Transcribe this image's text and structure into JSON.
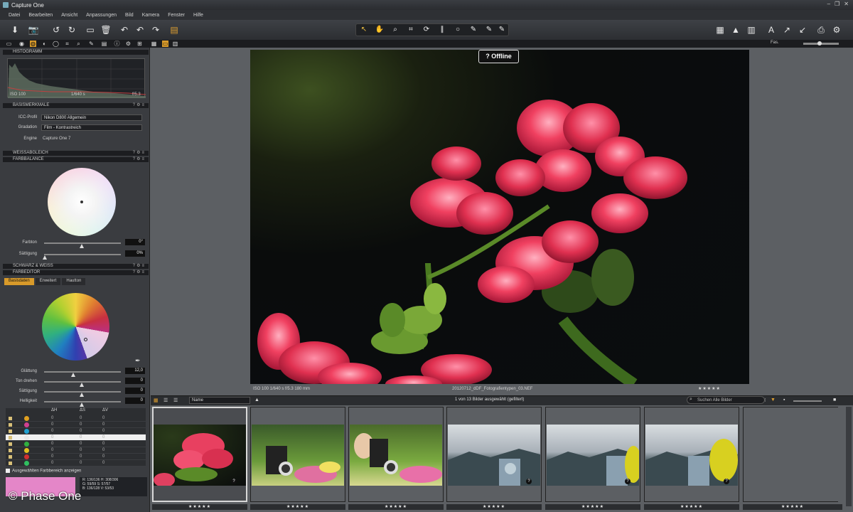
{
  "window": {
    "title": "Capture One"
  },
  "menu": [
    "Datei",
    "Bearbeiten",
    "Ansicht",
    "Anpassungen",
    "Bild",
    "Kamera",
    "Fenster",
    "Hilfe"
  ],
  "toolbar": {
    "fas_label": "Fas."
  },
  "sidebar": {
    "histogram": {
      "title": "Histogramm",
      "iso": "ISO 100",
      "shutter": "1/640 s",
      "aperture": "f/5.3"
    },
    "base": {
      "title": "Basismerkmale",
      "icc_label": "ICC-Profil",
      "icc_value": "Nikon D800 Allgemein",
      "curve_label": "Gradation",
      "curve_value": "Film - Kontrastreich",
      "engine_label": "Engine",
      "engine_value": "Capture One 7"
    },
    "wb": {
      "title": "Weissabgleich"
    },
    "colorbalance": {
      "title": "Farbbalance",
      "hue_label": "Farbton",
      "hue_value": "0°",
      "sat_label": "Sättigung",
      "sat_value": "0%"
    },
    "bw": {
      "title": "Schwarz & Weiß"
    },
    "coloreditor": {
      "title": "Farbeditor",
      "tabs": [
        "Basisdaten",
        "Erweitert",
        "Hautton"
      ],
      "smooth_label": "Glättung",
      "smooth_value": "12,0",
      "rot_label": "Ton drehen",
      "rot_value": "0",
      "sat_label": "Sättigung",
      "sat_value": "0",
      "light_label": "Helligkeit",
      "light_value": "0"
    },
    "cc_headers": [
      "ΔH",
      "ΔS",
      "ΔV"
    ],
    "cc_rows": [
      {
        "color": "#e0a020",
        "vals": [
          "0",
          "0",
          "0"
        ]
      },
      {
        "color": "#d04090",
        "vals": [
          "0",
          "0",
          "0"
        ]
      },
      {
        "color": "#20a0d0",
        "vals": [
          "0",
          "0",
          "0"
        ]
      },
      {
        "color": "#e8e8e8",
        "vals": [
          "0",
          "0",
          "0"
        ],
        "selected": true
      },
      {
        "color": "#30b040",
        "vals": [
          "0",
          "0",
          "0"
        ]
      },
      {
        "color": "#e0c020",
        "vals": [
          "0",
          "0",
          "0"
        ]
      },
      {
        "color": "#d03030",
        "vals": [
          "0",
          "0",
          "0"
        ]
      },
      {
        "color": "#30c060",
        "vals": [
          "0",
          "0",
          "0"
        ]
      }
    ],
    "show_selected": "Ausgewählten Farbbereich anzeigen",
    "readout": {
      "line1": "R: 136/136  H: 308/306",
      "line2": "G: 59/59  S: 57/57",
      "line3": "B: 136/128  V: 53/53"
    },
    "swatch_color": "#e486c8"
  },
  "copyright": "© Phase One",
  "viewer": {
    "badge": "Offline",
    "info_left": "ISO 100 1/640 s f/5.3 180 mm",
    "info_center": "20120712_dDF_Fotografientypen_03.NEF",
    "rating": "★★★★★"
  },
  "browser": {
    "sort_value": "Name",
    "count": "1 von 13 Bilder ausgewählt (gefiltert)",
    "search_placeholder": "Suchen Alle Bilder",
    "thumbs": [
      {
        "stars": "★★★★★"
      },
      {
        "stars": "★★★★★"
      },
      {
        "stars": "★★★★★"
      },
      {
        "stars": "★★★★★"
      },
      {
        "stars": "★★★★★"
      },
      {
        "stars": "★★★★★"
      },
      {
        "stars": "★★★★★"
      }
    ]
  }
}
